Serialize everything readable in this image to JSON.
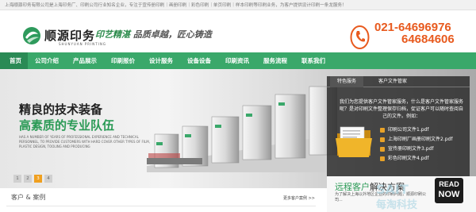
{
  "topbar": {
    "text": "上海顺源印务有限公司是上海印务厂、印刷公司行业知名企业，专注于宣传册印刷｜画册印刷｜彩色印刷｜单页印刷｜样本印刷等印刷业务，为客户提供设计印刷一条龙服务！"
  },
  "header": {
    "logo_name": "顺源印务",
    "logo_en": "SHUNYUAN PRINTING",
    "slogan_part1": "印艺精湛",
    "slogan_part2": "品质卓越，匠心铸造",
    "phone1": "021-64696976",
    "phone2": "64684606"
  },
  "nav": {
    "items": [
      {
        "label": "首页"
      },
      {
        "label": "公司介绍"
      },
      {
        "label": "产品展示"
      },
      {
        "label": "印刷报价"
      },
      {
        "label": "设计服务"
      },
      {
        "label": "设备设备"
      },
      {
        "label": "印刷资讯"
      },
      {
        "label": "服务流程"
      },
      {
        "label": "联系我们"
      }
    ]
  },
  "banner": {
    "title1": "精良的技术装备",
    "title2": "高素质的专业队伍",
    "subtext": "HAS A NUMBER OF YEARS OF PROFESSIONAL EXPERIENCE AND TECHNICAL PERSONNEL, TO PROVIDE CUSTOMERS WITH HARD COVER OTHER TYPES OF FILM, PLASTIC DESIGN, TOOLING AND PRODUCING",
    "dots": [
      "1",
      "2",
      "3",
      "4"
    ]
  },
  "panel": {
    "tab1": "特色服务",
    "tab2": "客户文件管家",
    "description": "我们为您提供客户文件管家服务，什么是客户文件管家服务呢？是对印刷文件整理保存归档，促证客户可以随时查阅自己的文件。例如：",
    "files": [
      "印刷公司文件1.pdf",
      "上海印刷厂画册印刷文件2.pdf",
      "宣传册印刷文件3.pdf",
      "彩色印刷文件4.pdf"
    ]
  },
  "bottom": {
    "case_title": "客户 & 案例",
    "more": "更多客户案例 >>",
    "remote_title_green": "远程客户",
    "remote_title_dark": "解决方案",
    "remote_desc": "为了解决上海以外地区企业的印刷问题，顺源印刷公司...",
    "read_now_1": "READ",
    "read_now_2": "NOW"
  },
  "colors": {
    "brand_green": "#3aa86a",
    "phone_orange": "#e85a1e",
    "panel_dark": "#282828"
  }
}
